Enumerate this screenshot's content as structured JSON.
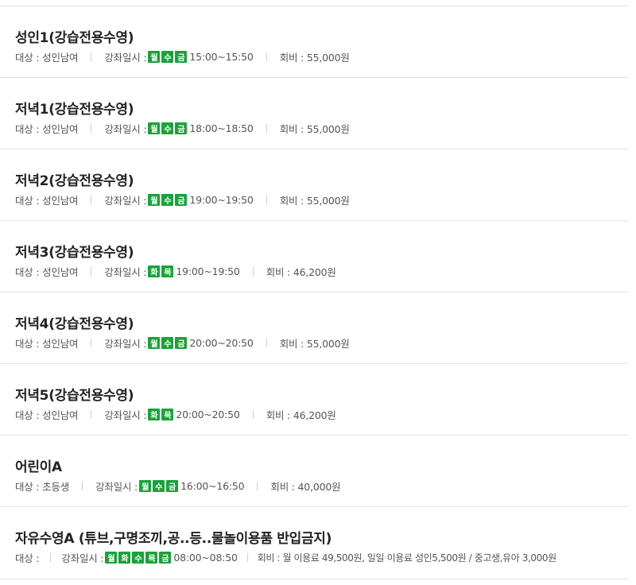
{
  "courses": [
    {
      "title": "성인1(강습전용수영)",
      "target_label": "대상 : 성인남여",
      "schedule_label": "강좌일시 :",
      "days": [
        "월",
        "수",
        "금"
      ],
      "time": "15:00~15:50",
      "fee": "회비 : 55,000원"
    },
    {
      "title": "저녁1(강습전용수영)",
      "target_label": "대상 : 성인남여",
      "schedule_label": "강좌일시 :",
      "days": [
        "월",
        "수",
        "금"
      ],
      "time": "18:00~18:50",
      "fee": "회비 : 55,000원"
    },
    {
      "title": "저녁2(강습전용수영)",
      "target_label": "대상 : 성인남여",
      "schedule_label": "강좌일시 :",
      "days": [
        "월",
        "수",
        "금"
      ],
      "time": "19:00~19:50",
      "fee": "회비 : 55,000원"
    },
    {
      "title": "저녁3(강습전용수영)",
      "target_label": "대상 : 성인남여",
      "schedule_label": "강좌일시 :",
      "days": [
        "화",
        "목"
      ],
      "time": "19:00~19:50",
      "fee": "회비 : 46,200원"
    },
    {
      "title": "저녁4(강습전용수영)",
      "target_label": "대상 : 성인남여",
      "schedule_label": "강좌일시 :",
      "days": [
        "월",
        "수",
        "금"
      ],
      "time": "20:00~20:50",
      "fee": "회비 : 55,000원"
    },
    {
      "title": "저녁5(강습전용수영)",
      "target_label": "대상 : 성인남여",
      "schedule_label": "강좌일시 :",
      "days": [
        "화",
        "목"
      ],
      "time": "20:00~20:50",
      "fee": "회비 : 46,200원"
    },
    {
      "title": "어린이A",
      "target_label": "대상 : 초등생",
      "schedule_label": "강좌일시 :",
      "days": [
        "월",
        "수",
        "금"
      ],
      "time": "16:00~16:50",
      "fee": "회비 : 40,000원"
    },
    {
      "title": "자유수영A (튜브,구명조끼,공..등..물놀이용품 반입금지)",
      "target_label": "대상 :",
      "schedule_label": "강좌일시 :",
      "days": [
        "월",
        "화",
        "수",
        "목",
        "금"
      ],
      "time": "08:00~08:50",
      "fee": "회비 : 월 이용료 49,500원, 일일 이용료 성인5,500원 / 중고생,유아 3,000원"
    }
  ],
  "colors": {
    "day_badge": "#1aa33a",
    "divider": "#e2e2e2"
  }
}
